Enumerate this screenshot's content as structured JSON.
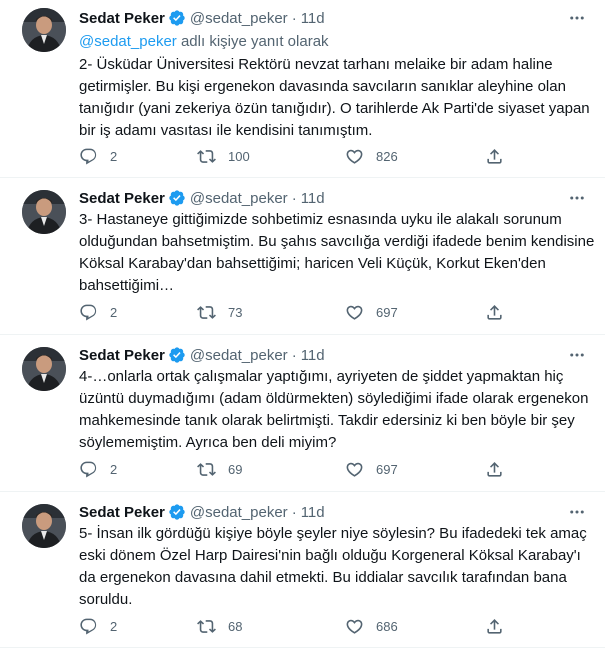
{
  "colors": {
    "accent": "#1d9bf0",
    "text": "#0f1419",
    "secondary": "#536471",
    "divider": "#eff3f4"
  },
  "icons": {
    "verified": "verified-badge-icon",
    "more": "more-horizontal-icon",
    "reply": "reply-icon",
    "retweet": "retweet-icon",
    "like": "heart-icon",
    "share": "share-icon"
  },
  "tweets": [
    {
      "name": "Sedat Peker",
      "handle": "@sedat_peker",
      "dot": "·",
      "time": "11d",
      "reply_to_handle": "@sedat_peker",
      "reply_to_suffix": " adlı kişiye yanıt olarak",
      "text": "2- Üsküdar Üniversitesi Rektörü nevzat tarhanı melaike bir adam haline getirmişler. Bu kişi ergenekon davasında savcıların sanıklar aleyhine olan tanığıdır (yani zekeriya özün tanığıdır). O tarihlerde Ak Parti'de siyaset yapan bir iş adamı vasıtası ile kendisini tanımıştım.",
      "replies": "2",
      "retweets": "100",
      "likes": "826"
    },
    {
      "name": "Sedat Peker",
      "handle": "@sedat_peker",
      "dot": "·",
      "time": "11d",
      "text": "3- Hastaneye gittiğimizde sohbetimiz esnasında uyku ile alakalı sorunum olduğundan bahsetmiştim. Bu şahıs savcılığa verdiği ifadede benim kendisine Köksal Karabay'dan bahsettiğimi; haricen Veli Küçük, Korkut Eken'den bahsettiğimi…",
      "replies": "2",
      "retweets": "73",
      "likes": "697"
    },
    {
      "name": "Sedat Peker",
      "handle": "@sedat_peker",
      "dot": "·",
      "time": "11d",
      "text": "4-…onlarla ortak çalışmalar yaptığımı, ayriyeten de şiddet yapmaktan hiç üzüntü duymadığımı (adam öldürmekten) söylediğimi ifade olarak ergenekon mahkemesinde tanık olarak belirtmişti. Takdir edersiniz ki ben böyle bir şey söylememiştim. Ayrıca ben deli miyim?",
      "replies": "2",
      "retweets": "69",
      "likes": "697"
    },
    {
      "name": "Sedat Peker",
      "handle": "@sedat_peker",
      "dot": "·",
      "time": "11d",
      "text": "5- İnsan ilk gördüğü kişiye böyle şeyler niye söylesin? Bu ifadedeki tek amaç eski dönem Özel Harp Dairesi'nin bağlı olduğu Korgeneral Köksal Karabay'ı da ergenekon davasına dahil etmekti. Bu iddialar savcılık tarafından bana soruldu.",
      "replies": "2",
      "retweets": "68",
      "likes": "686"
    }
  ]
}
